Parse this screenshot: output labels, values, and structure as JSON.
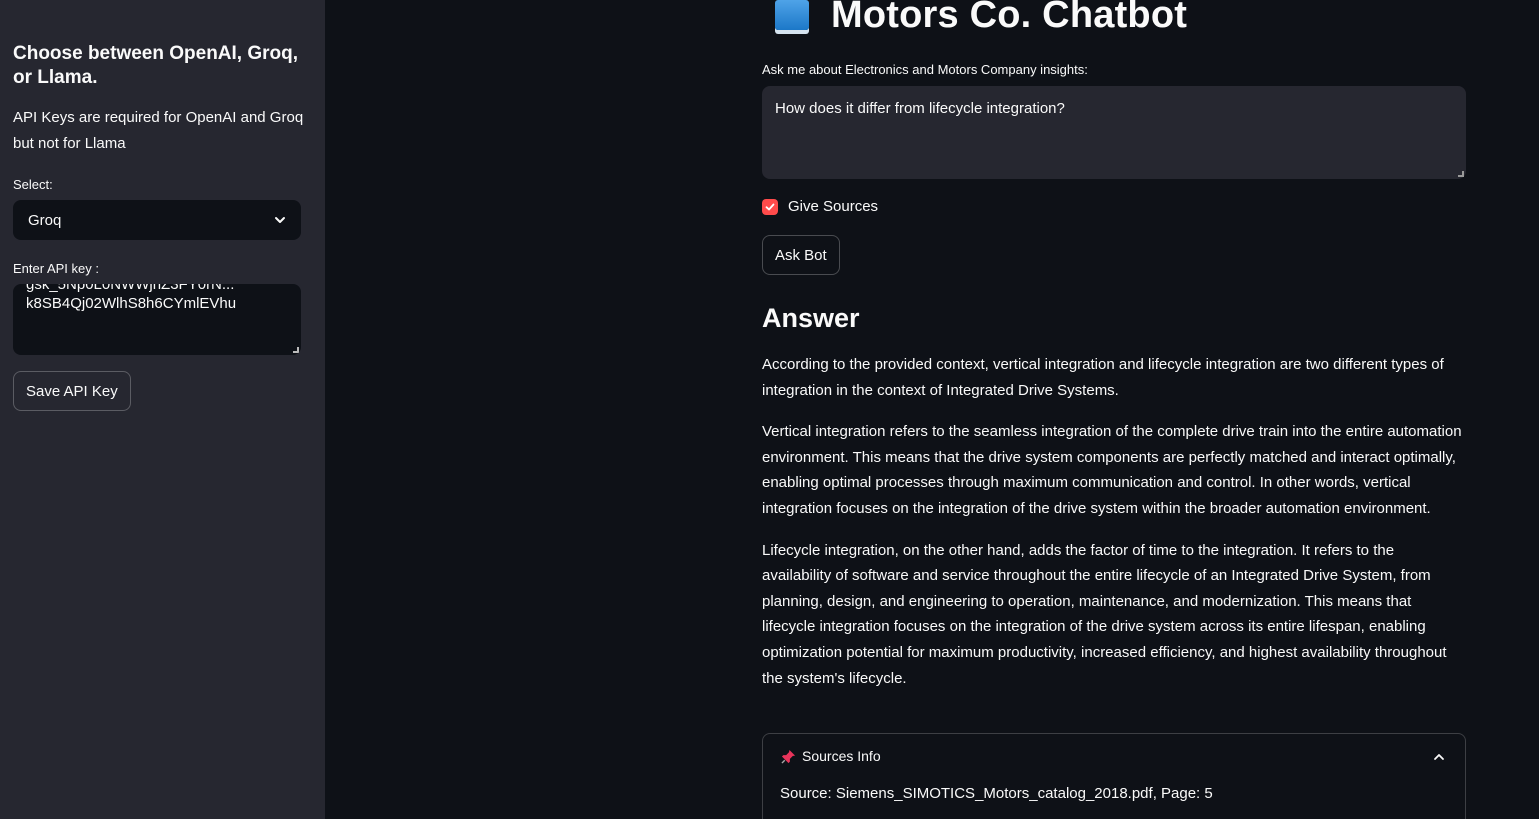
{
  "sidebar": {
    "title": "Choose between OpenAI, Groq, or Llama.",
    "note": "API Keys are required for OpenAI and Groq but not for Llama",
    "select_label": "Select:",
    "select_value": "Groq",
    "api_label": "Enter API key :",
    "api_value_line1": "gsk_5Np0L0NWWjhZ3FY0rN...",
    "api_value_line2": "k8SB4Qj02WlhS8h6CYmlEVhu",
    "save_button": "Save API Key"
  },
  "main": {
    "title": "Motors Co. Chatbot",
    "title_icon": "book-icon",
    "question_label": "Ask me about Electronics and Motors Company insights:",
    "question_value": "How does it differ from lifecycle integration?",
    "give_sources_label": "Give Sources",
    "give_sources_checked": true,
    "ask_button": "Ask Bot",
    "answer_heading": "Answer",
    "answer_paragraphs": [
      "According to the provided context, vertical integration and lifecycle integration are two different types of integration in the context of Integrated Drive Systems.",
      "Vertical integration refers to the seamless integration of the complete drive train into the entire automation environment. This means that the drive system components are perfectly matched and interact optimally, enabling optimal processes through maximum communication and control. In other words, vertical integration focuses on the integration of the drive system within the broader automation environment.",
      "Lifecycle integration, on the other hand, adds the factor of time to the integration. It refers to the availability of software and service throughout the entire lifecycle of an Integrated Drive System, from planning, design, and engineering to operation, maintenance, and modernization. This means that lifecycle integration focuses on the integration of the drive system across its entire lifespan, enabling optimization potential for maximum productivity, increased efficiency, and highest availability throughout the system's lifecycle."
    ],
    "sources_header": "Sources Info",
    "sources_icon": "pushpin-icon",
    "source_text": "Source: Siemens_SIMOTICS_Motors_catalog_2018.pdf, Page: 5"
  },
  "colors": {
    "background": "#0e1117",
    "sidebar": "#262730",
    "accent": "#ff4b4b"
  }
}
